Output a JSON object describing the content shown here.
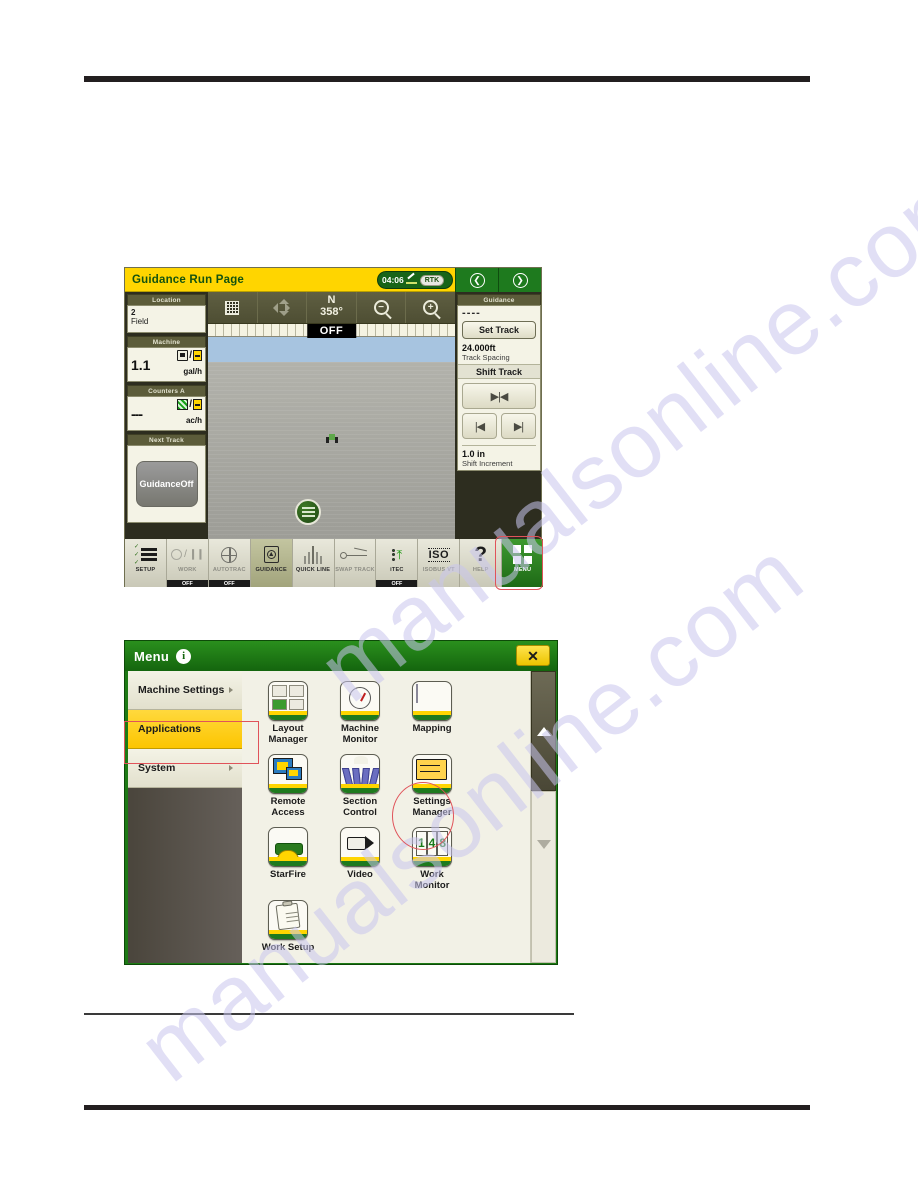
{
  "watermark": {
    "line1": "manualsonline.com",
    "line2": "manualsonline.com"
  },
  "screen1": {
    "title": "Guidance Run Page",
    "status": {
      "time": "04:06",
      "correction": "RTK",
      "sat_icon": "satellite-icon"
    },
    "nav": {
      "back_icon": "arrow-left-circle-icon",
      "forward_icon": "arrow-right-circle-icon"
    },
    "left_panel": {
      "location": {
        "header": "Location",
        "value": "2",
        "label": "Field"
      },
      "machine": {
        "header": "Machine",
        "value": "1.1",
        "unit": "gal/h",
        "icon_fuel": "fuel-icon",
        "icon_time": "hour-glass-icon",
        "separator": "/"
      },
      "counters": {
        "header": "Counters A",
        "value": "---",
        "unit": "ac/h",
        "icon_area": "area-hatch-icon",
        "icon_time": "hour-glass-icon",
        "separator": "/"
      },
      "next_track": {
        "header": "Next Track",
        "button_line1": "Guidance",
        "button_line2": "Off"
      }
    },
    "map_toolbar": {
      "grid_icon": "map-layers-icon",
      "pan_icon": "pan-dpad-icon",
      "heading_letter": "N",
      "heading_value": "358°",
      "zoom_out_icon": "zoom-out-icon",
      "zoom_in_icon": "zoom-in-icon",
      "zoom_out_sign": "−",
      "zoom_in_sign": "+"
    },
    "map": {
      "off_badge": "OFF",
      "vehicle_icon": "tractor-icon",
      "menu_fab_icon": "list-menu-icon"
    },
    "right_panel": {
      "header": "Guidance",
      "track_name": "- - - -",
      "set_track_label": "Set Track",
      "spacing_value": "24.000ft",
      "spacing_label": "Track Spacing",
      "shift_track_header": "Shift Track",
      "center_icon": "▶|◀",
      "left_icon": "|◀",
      "right_icon": "▶|",
      "increment_value": "1.0 in",
      "increment_label": "Shift Increment"
    },
    "toolbar": [
      {
        "label": "SETUP",
        "icon": "setup-checklist-icon",
        "state": "",
        "active": false,
        "dim": false
      },
      {
        "label": "WORK",
        "icon": "work-pause-icon",
        "state": "OFF",
        "active": false,
        "dim": true
      },
      {
        "label": "AUTOTRAC",
        "icon": "autotrac-wheel-icon",
        "state": "OFF",
        "active": false,
        "dim": true
      },
      {
        "label": "GUIDANCE",
        "icon": "guidance-compass-icon",
        "state": "",
        "active": true,
        "dim": false
      },
      {
        "label": "QUICK LINE",
        "icon": "quick-line-icon",
        "state": "",
        "active": false,
        "dim": false
      },
      {
        "label": "SWAP TRACK",
        "icon": "swap-track-icon",
        "state": "",
        "active": false,
        "dim": true
      },
      {
        "label": "iTEC",
        "icon": "itec-sequence-icon",
        "state": "OFF",
        "active": false,
        "dim": false
      },
      {
        "label": "ISOBUS VT",
        "icon": "iso-icon",
        "state": "",
        "active": false,
        "dim": true
      },
      {
        "label": "HELP",
        "icon": "question-mark-icon",
        "state": "",
        "active": false,
        "dim": true
      },
      {
        "label": "MENU",
        "icon": "grid-menu-icon",
        "state": "",
        "active": false,
        "dim": false
      }
    ],
    "iso_icon_text": "ISO",
    "help_icon_text": "?"
  },
  "screen2": {
    "title": "Menu",
    "info_icon": "info-icon",
    "info_glyph": "i",
    "close_icon": "close-icon",
    "close_glyph": "✕",
    "nav_items": [
      {
        "label": "Machine Settings",
        "selected": false
      },
      {
        "label": "Applications",
        "selected": true
      },
      {
        "label": "System",
        "selected": false
      }
    ],
    "apps": [
      {
        "label": "Layout\nManager",
        "line1": "Layout",
        "line2": "Manager",
        "icon": "layout-manager-icon",
        "art": "art-layout"
      },
      {
        "label": "Machine Monitor",
        "line1": "Machine",
        "line2": "Monitor",
        "icon": "machine-monitor-icon",
        "art": "art-mon"
      },
      {
        "label": "Mapping",
        "line1": "Mapping",
        "line2": "",
        "icon": "mapping-icon",
        "art": "art-map"
      },
      {
        "label": "Remote Access",
        "line1": "Remote",
        "line2": "Access",
        "icon": "remote-access-icon",
        "art": "art-remote"
      },
      {
        "label": "Section Control",
        "line1": "Section",
        "line2": "Control",
        "icon": "section-control-icon",
        "art": "art-sect"
      },
      {
        "label": "Settings Manager",
        "line1": "Settings",
        "line2": "Manager",
        "icon": "settings-manager-icon",
        "art": "art-settings"
      },
      {
        "label": "StarFire",
        "line1": "StarFire",
        "line2": "",
        "icon": "starfire-icon",
        "art": "art-star"
      },
      {
        "label": "Video",
        "line1": "Video",
        "line2": "",
        "icon": "video-icon",
        "art": "art-video"
      },
      {
        "label": "Work Monitor",
        "line1": "Work",
        "line2": "Monitor",
        "icon": "work-monitor-icon",
        "art": "art-wm"
      },
      {
        "label": "Work Setup",
        "line1": "Work Setup",
        "line2": "",
        "icon": "work-setup-icon",
        "art": "art-ws"
      }
    ],
    "work_monitor_digits": {
      "d1": "1",
      "d2": "4",
      "d3": "8"
    },
    "scrollbar": {
      "up_icon": "scroll-up-arrow-icon",
      "down_icon": "scroll-down-arrow-icon"
    }
  },
  "colors": {
    "jd_green": "#1e7a1e",
    "jd_yellow": "#ffd500",
    "highlight_red": "#e0535a"
  }
}
